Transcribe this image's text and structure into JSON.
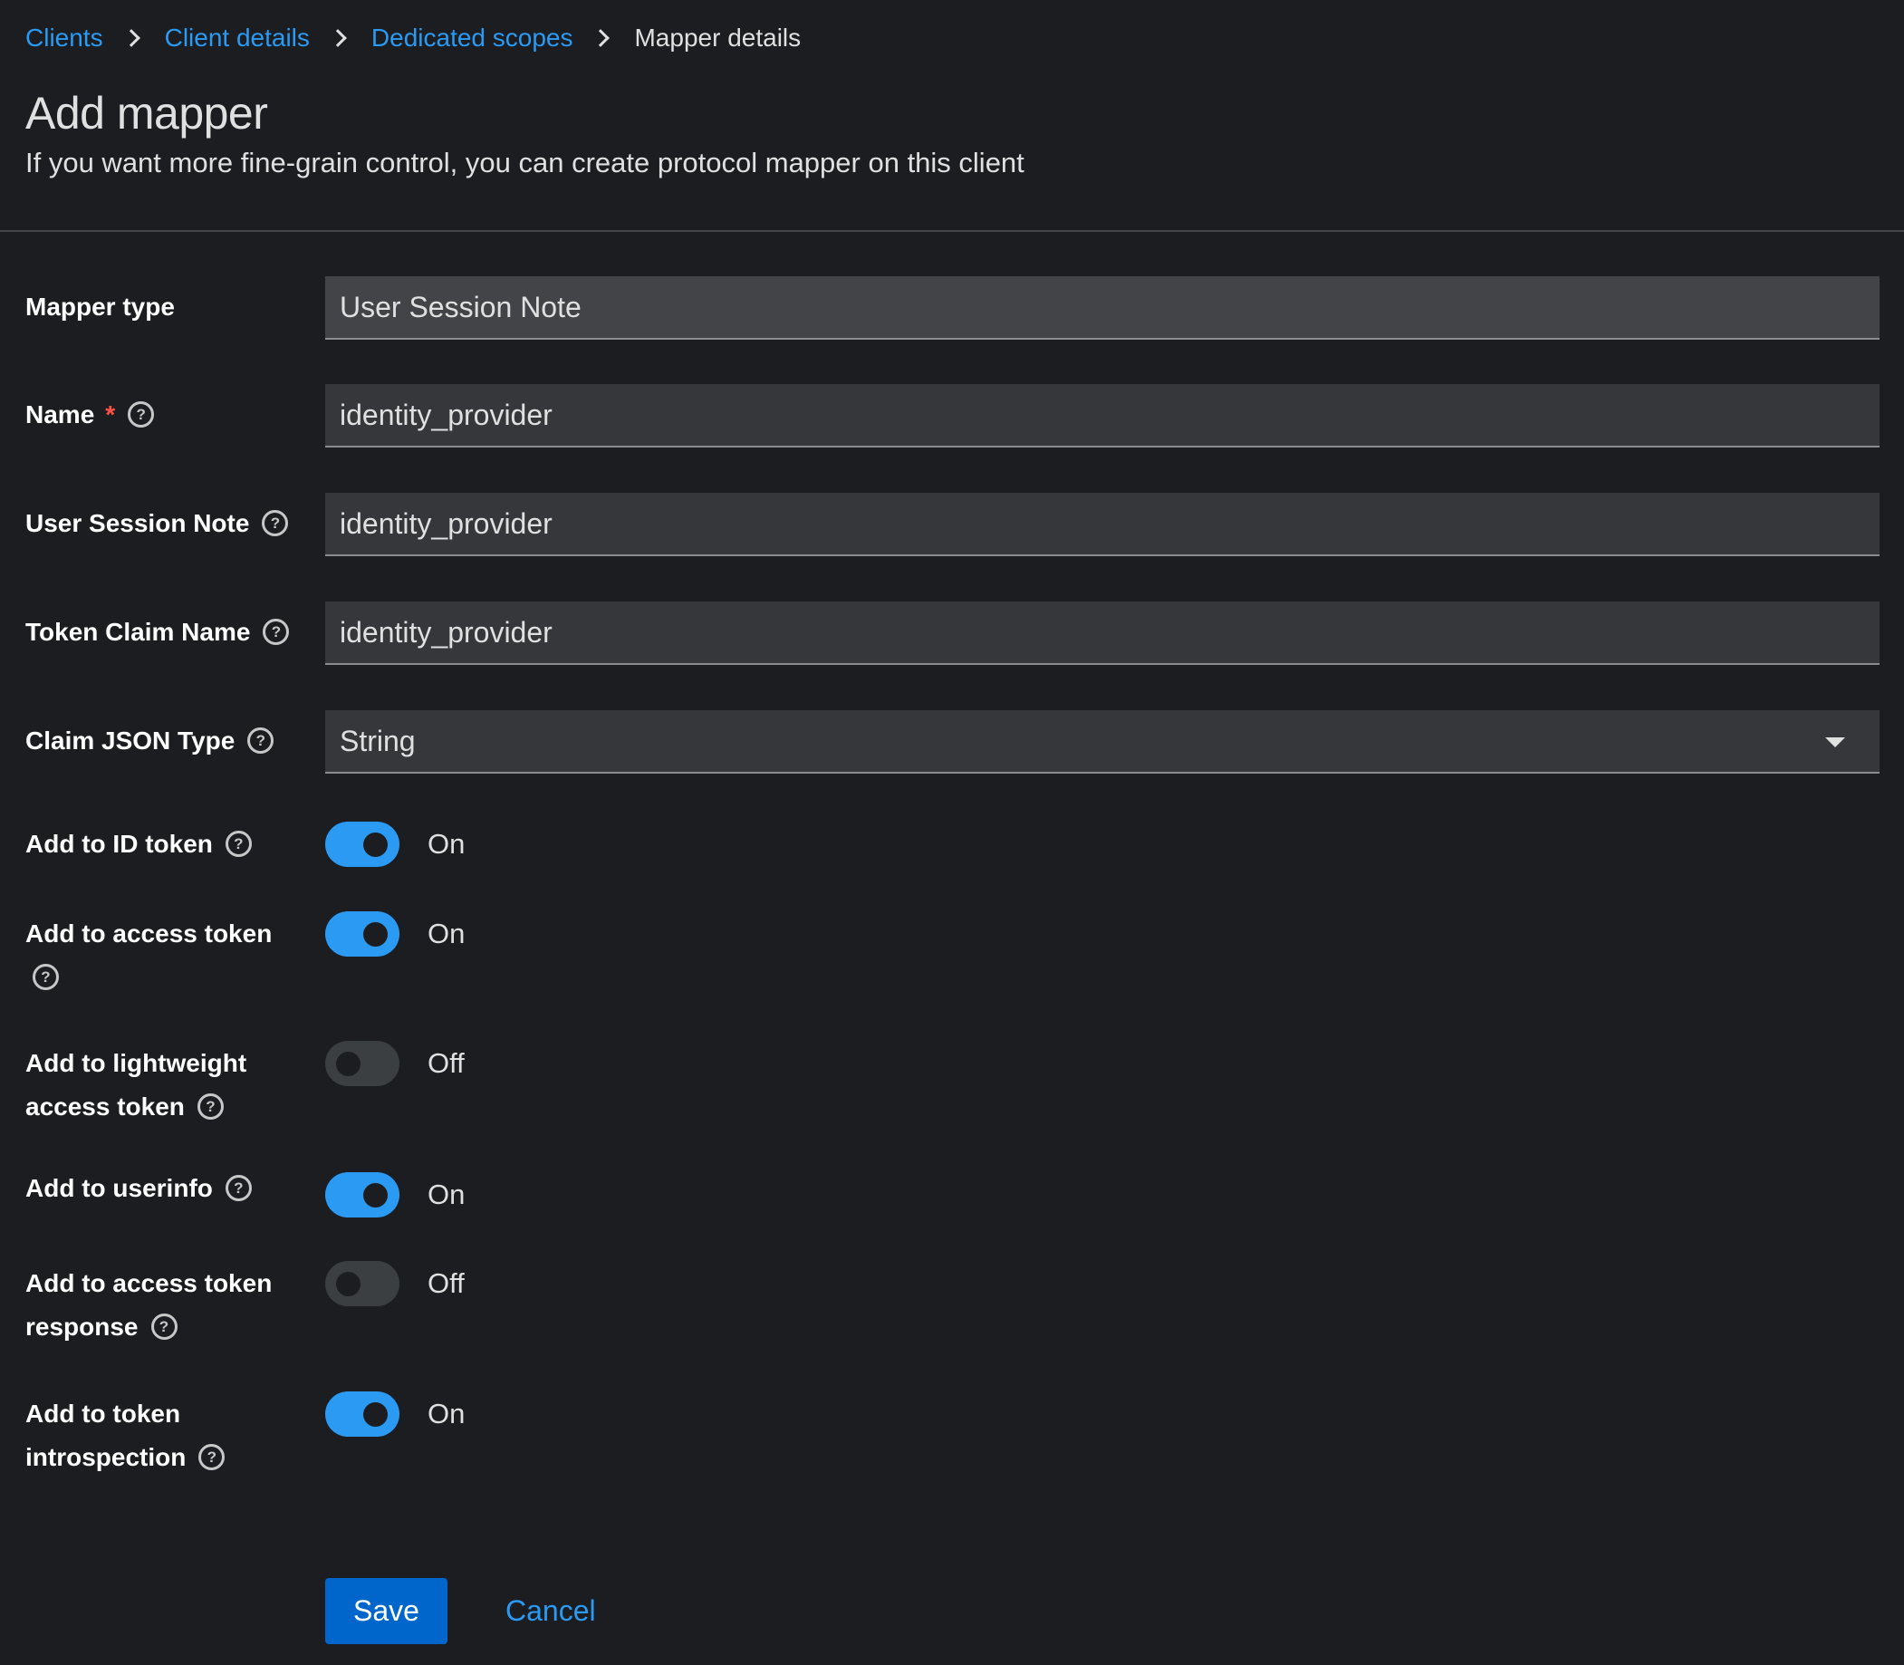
{
  "breadcrumb": {
    "items": [
      "Clients",
      "Client details",
      "Dedicated scopes"
    ],
    "current": "Mapper details"
  },
  "header": {
    "title": "Add mapper",
    "description": "If you want more fine-grain control, you can create protocol mapper on this client"
  },
  "form": {
    "mapper_type": {
      "label": "Mapper type",
      "value": "User Session Note"
    },
    "name": {
      "label": "Name",
      "required_mark": "*",
      "value": "identity_provider"
    },
    "user_session_note": {
      "label": "User Session Note",
      "value": "identity_provider"
    },
    "token_claim_name": {
      "label": "Token Claim Name",
      "value": "identity_provider"
    },
    "claim_json_type": {
      "label": "Claim JSON Type",
      "value": "String"
    },
    "toggles": [
      {
        "label_line1": "Add to ID token",
        "label_line2": "",
        "state": "On",
        "on": true
      },
      {
        "label_line1": "Add to access token",
        "label_line2": "",
        "state": "On",
        "on": true
      },
      {
        "label_line1": "Add to lightweight",
        "label_line2": "access token",
        "state": "Off",
        "on": false
      },
      {
        "label_line1": "Add to userinfo",
        "label_line2": "",
        "state": "On",
        "on": true
      },
      {
        "label_line1": "Add to access token",
        "label_line2": "response",
        "state": "Off",
        "on": false
      },
      {
        "label_line1": "Add to token",
        "label_line2": "introspection",
        "state": "On",
        "on": true
      }
    ]
  },
  "help_glyph": "?",
  "actions": {
    "save": "Save",
    "cancel": "Cancel"
  },
  "colors": {
    "background": "#1b1d21",
    "link": "#2b9af3",
    "primary_button": "#0066cc",
    "switch_on": "#2b9af3",
    "required": "#fe5142"
  }
}
